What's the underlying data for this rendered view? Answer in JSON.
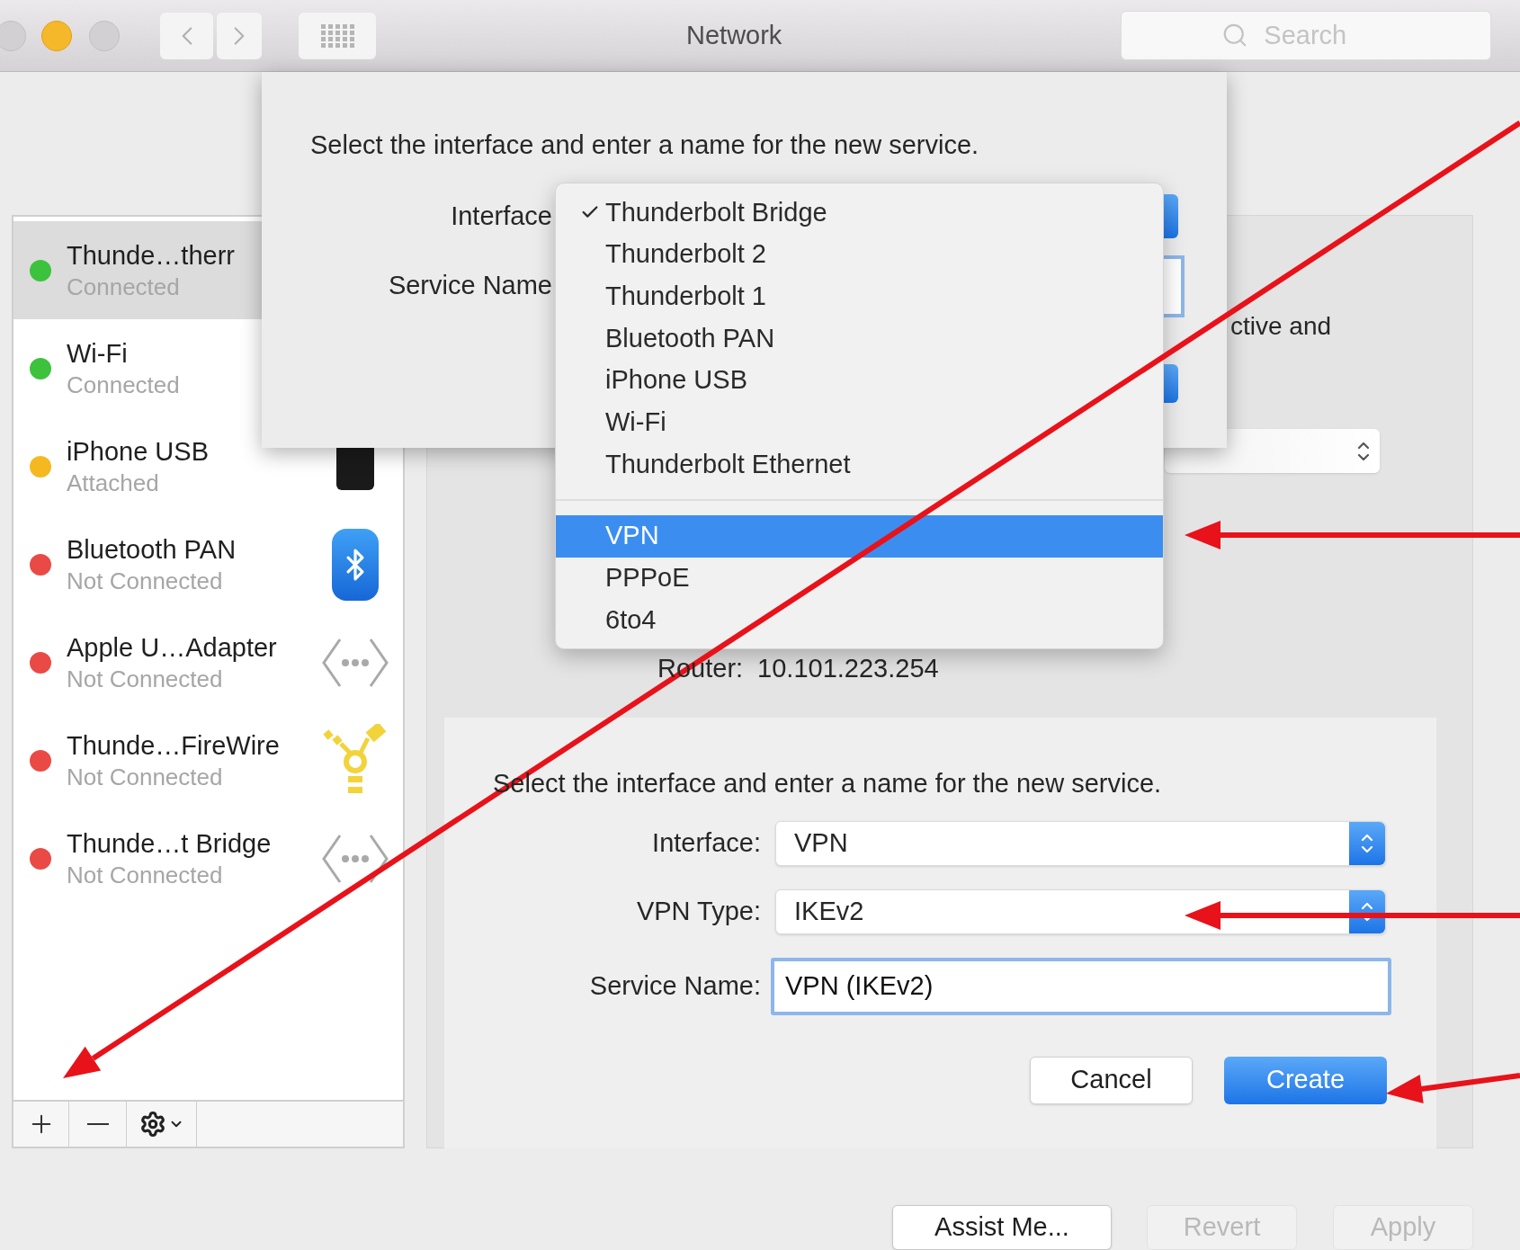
{
  "window": {
    "title": "Network"
  },
  "toolbar": {
    "search": {
      "placeholder": "Search"
    }
  },
  "sidebar": {
    "services": [
      {
        "name": "Thunde…therr",
        "status": "Connected",
        "color": "#3cc23c",
        "selected": true
      },
      {
        "name": "Wi-Fi",
        "status": "Connected",
        "color": "#3cc23c",
        "selected": false
      },
      {
        "name": "iPhone USB",
        "status": "Attached",
        "color": "#f5b820",
        "selected": false,
        "kind": "phone"
      },
      {
        "name": "Bluetooth PAN",
        "status": "Not Connected",
        "color": "#ea4a45",
        "selected": false,
        "kind": "bluetooth"
      },
      {
        "name": "Apple U…Adapter",
        "status": "Not Connected",
        "color": "#ea4a45",
        "selected": false,
        "kind": "ethernet"
      },
      {
        "name": "Thunde…FireWire",
        "status": "Not Connected",
        "color": "#ea4a45",
        "selected": false,
        "kind": "firewire"
      },
      {
        "name": "Thunde…t Bridge",
        "status": "Not Connected",
        "color": "#ea4a45",
        "selected": false,
        "kind": "ethernet"
      }
    ]
  },
  "main": {
    "description": "ctive and",
    "router_label": "Router:",
    "router_value": "10.101.223.254"
  },
  "sheet": {
    "prompt": "Select the interface and enter a name for the new service.",
    "interface_label": "Interface",
    "service_name_label": "Service Name"
  },
  "interface_menu": {
    "items": [
      {
        "kind": "item",
        "label": "Thunderbolt Bridge",
        "checked": true,
        "selected": false
      },
      {
        "kind": "item",
        "label": "Thunderbolt 2",
        "checked": false,
        "selected": false
      },
      {
        "kind": "item",
        "label": "Thunderbolt 1",
        "checked": false,
        "selected": false
      },
      {
        "kind": "item",
        "label": "Bluetooth PAN",
        "checked": false,
        "selected": false
      },
      {
        "kind": "item",
        "label": "iPhone USB",
        "checked": false,
        "selected": false
      },
      {
        "kind": "item",
        "label": "Wi-Fi",
        "checked": false,
        "selected": false
      },
      {
        "kind": "item",
        "label": "Thunderbolt Ethernet",
        "checked": false,
        "selected": false
      },
      {
        "kind": "separator"
      },
      {
        "kind": "item",
        "label": "VPN",
        "checked": false,
        "selected": true
      },
      {
        "kind": "item",
        "label": "PPPoE",
        "checked": false,
        "selected": false
      },
      {
        "kind": "item",
        "label": "6to4",
        "checked": false,
        "selected": false
      }
    ]
  },
  "new_service_panel": {
    "prompt": "Select the interface and enter a name for the new service.",
    "fields": [
      {
        "kind": "popup",
        "label": "Interface:",
        "value": "VPN"
      },
      {
        "kind": "popup",
        "label": "VPN Type:",
        "value": "IKEv2"
      },
      {
        "kind": "text",
        "label": "Service Name:",
        "value": "VPN (IKEv2)"
      }
    ],
    "buttons": [
      {
        "label": "Cancel",
        "default": false
      },
      {
        "label": "Create",
        "default": true
      }
    ]
  },
  "footer": {
    "buttons": [
      {
        "label": "Assist Me...",
        "disabled": false
      },
      {
        "label": "Revert",
        "disabled": true
      },
      {
        "label": "Apply",
        "disabled": true
      }
    ]
  }
}
